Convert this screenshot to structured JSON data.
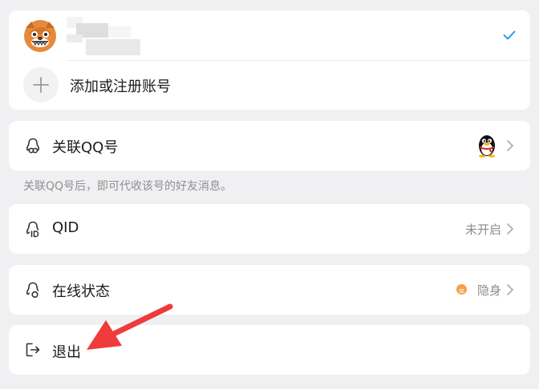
{
  "accounts": {
    "checkmark": "check-icon",
    "add_account_label": "添加或注册账号"
  },
  "linked_qq": {
    "label": "关联QQ号",
    "hint": "关联QQ号后，即可代收该号的好友消息。"
  },
  "qid": {
    "label": "QID",
    "value": "未开启"
  },
  "online_status": {
    "label": "在线状态",
    "value": "隐身",
    "status_color": "#f5a04a"
  },
  "logout": {
    "label": "退出"
  },
  "colors": {
    "accent": "#1e8fe6",
    "background": "#f0f0f3",
    "annotation_arrow": "#ee3b3b"
  }
}
